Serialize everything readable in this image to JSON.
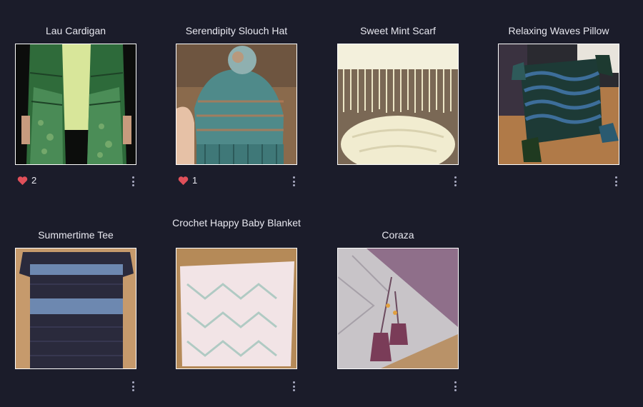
{
  "projects": [
    {
      "title": "Lau Cardigan",
      "likes": "2",
      "menu_icon": "more-vertical-icon"
    },
    {
      "title": "Serendipity Slouch Hat",
      "likes": "1",
      "menu_icon": "more-vertical-icon"
    },
    {
      "title": "Sweet Mint Scarf",
      "likes": "",
      "menu_icon": "more-vertical-icon"
    },
    {
      "title": "Relaxing Waves Pillow",
      "likes": "",
      "menu_icon": "more-vertical-icon"
    },
    {
      "title": "Summertime Tee",
      "likes": "",
      "menu_icon": "more-vertical-icon"
    },
    {
      "title": "Crochet Happy Baby Blanket",
      "likes": "",
      "menu_icon": "more-vertical-icon"
    },
    {
      "title": "Coraza",
      "likes": "",
      "menu_icon": "more-vertical-icon"
    }
  ],
  "colors": {
    "background": "#1b1c2a",
    "heart": "#e0505a",
    "text": "#e8e8f0"
  }
}
